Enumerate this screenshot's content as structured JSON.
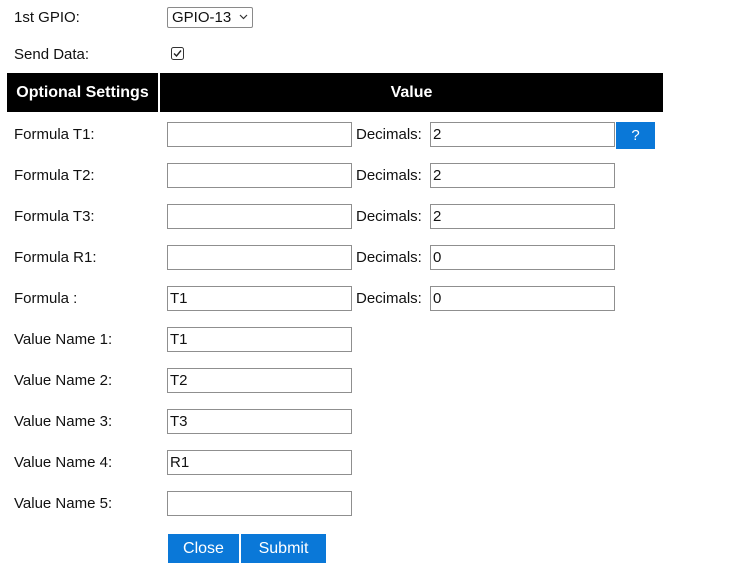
{
  "gpio": {
    "label": "1st GPIO:",
    "selected": "GPIO-13",
    "chevron": "⌵"
  },
  "send_data": {
    "label": "Send Data:",
    "checked": true,
    "mark": "☑"
  },
  "table_header": {
    "col1": "Optional Settings",
    "col2": "Value"
  },
  "decimals_label": "Decimals:",
  "help_button": "?",
  "formulas": [
    {
      "label": "Formula T1:",
      "value": "",
      "decimals": "2"
    },
    {
      "label": "Formula T2:",
      "value": "",
      "decimals": "2"
    },
    {
      "label": "Formula T3:",
      "value": "",
      "decimals": "2"
    },
    {
      "label": "Formula R1:",
      "value": "",
      "decimals": "0"
    },
    {
      "label": "Formula :",
      "value": "T1",
      "decimals": "0"
    }
  ],
  "value_names": [
    {
      "label": "Value Name 1:",
      "value": "T1"
    },
    {
      "label": "Value Name 2:",
      "value": "T2"
    },
    {
      "label": "Value Name 3:",
      "value": "T3"
    },
    {
      "label": "Value Name 4:",
      "value": "R1"
    },
    {
      "label": "Value Name 5:",
      "value": ""
    }
  ],
  "buttons": {
    "close": "Close",
    "submit": "Submit"
  },
  "colors": {
    "accent": "#0a78d8",
    "header_bg": "#000000"
  },
  "icons": {
    "dropdown": "chevron-down-icon",
    "checkbox": "checkbox-checked-icon"
  }
}
